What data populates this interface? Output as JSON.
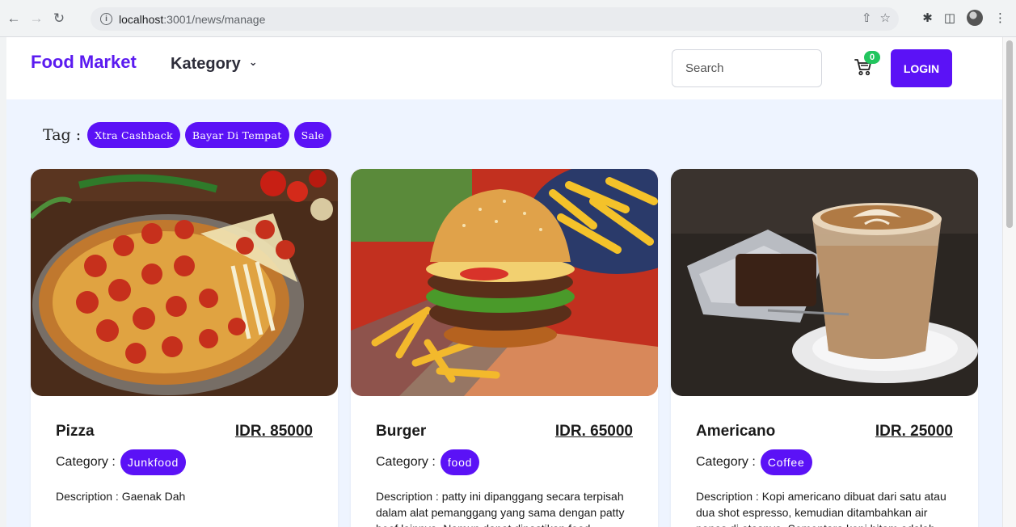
{
  "browser": {
    "url_host": "localhost",
    "url_path": ":3001/news/manage"
  },
  "navbar": {
    "brand": "Food Market",
    "kategory_label": "Kategory",
    "search_placeholder": "Search",
    "cart_count": "0",
    "login_label": "LOGIN"
  },
  "tags": {
    "label": "Tag :",
    "items": [
      "Xtra Cashback",
      "Bayar Di Tempat",
      "Sale"
    ]
  },
  "products": [
    {
      "name": "Pizza",
      "price": "IDR. 85000",
      "category_label": "Category :",
      "category": "Junkfood",
      "description": "Description : Gaenak Dah"
    },
    {
      "name": "Burger",
      "price": "IDR. 65000",
      "category_label": "Category :",
      "category": "food",
      "description": "Description : patty ini dipanggang secara terpisah dalam alat pemanggang yang sama dengan patty beef lainnya. Namun dapat dipastikan food"
    },
    {
      "name": "Americano",
      "price": "IDR. 25000",
      "category_label": "Category :",
      "category": "Coffee",
      "description": "Description : Kopi americano dibuat dari satu atau dua shot espresso, kemudian ditambahkan air panas di atasnya. Sementara kopi hitam adalah"
    }
  ],
  "colors": {
    "brand": "#5b1bf0",
    "accent": "#5b12f6",
    "badge": "#22c55e",
    "page_bg": "#eef4ff"
  }
}
